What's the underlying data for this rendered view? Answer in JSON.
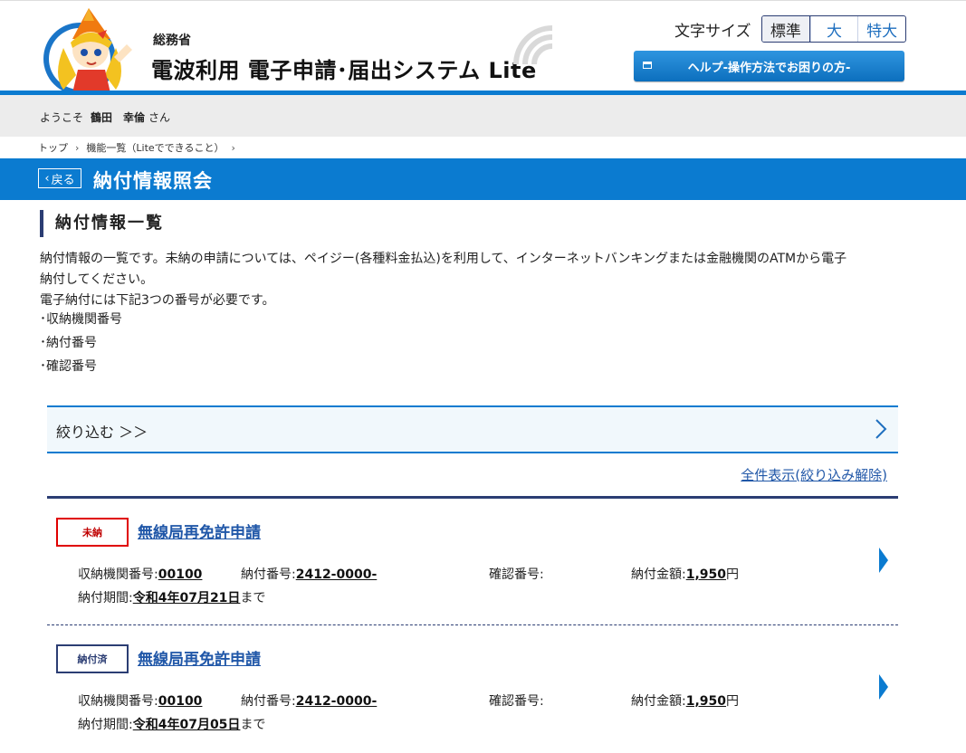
{
  "header": {
    "ministry": "総務省",
    "title": "電波利用 電子申請･届出システム Lite",
    "font_size_label": "文字サイズ",
    "font_size_options": [
      "標準",
      "大",
      "特大"
    ],
    "help_button": "ヘルプ-操作方法でお困りの方-"
  },
  "user": {
    "prefix": "ようこそ",
    "family_name": "鶴田",
    "given_name": "幸倫",
    "suffix": "さん"
  },
  "breadcrumb": [
    "トップ",
    "機能一覧（Liteでできること）"
  ],
  "page": {
    "back_label": "戻る",
    "title": "納付情報照会"
  },
  "section": {
    "title": "納付情報一覧",
    "description": [
      "納付情報の一覧です。未納の申請については、ペイジー(各種料金払込)を利用して、インターネットバンキングまたは金融機関のATMから電子",
      "納付してください。",
      "電子納付には下記3つの番号が必要です。"
    ],
    "bullets": [
      "･収納機関番号",
      "･納付番号",
      "･確認番号"
    ]
  },
  "filter": {
    "label": "絞り込む ＞＞"
  },
  "show_all_link": "全件表示(絞り込み解除)",
  "field_labels": {
    "institution": "収納機関番号:",
    "payment_no": "納付番号:",
    "confirm_no": "確認番号:",
    "amount": "納付金額:",
    "period": "納付期間:"
  },
  "entries": [
    {
      "status": "未納",
      "title": "無線局再免許申請",
      "institution_no": "00100",
      "payment_no": "2412-0000-",
      "confirm_no": "",
      "amount": "1,950",
      "amount_unit": "円",
      "period": "令和4年07月21日",
      "period_suffix": "まで"
    },
    {
      "status": "納付済",
      "title": "無線局再免許申請",
      "institution_no": "00100",
      "payment_no": "2412-0000-",
      "confirm_no": "",
      "amount": "1,950",
      "amount_unit": "円",
      "period": "令和4年07月05日",
      "period_suffix": "まで"
    }
  ],
  "colors": {
    "brand_blue": "#0b7bd0",
    "navy": "#2b3d73",
    "unpaid_red": "#e00000",
    "link_blue": "#2057a8"
  },
  "icons": [
    "mascot-logo",
    "radio-waves-icon",
    "window-icon",
    "chevron-right-icon",
    "back-chevron-icon"
  ]
}
